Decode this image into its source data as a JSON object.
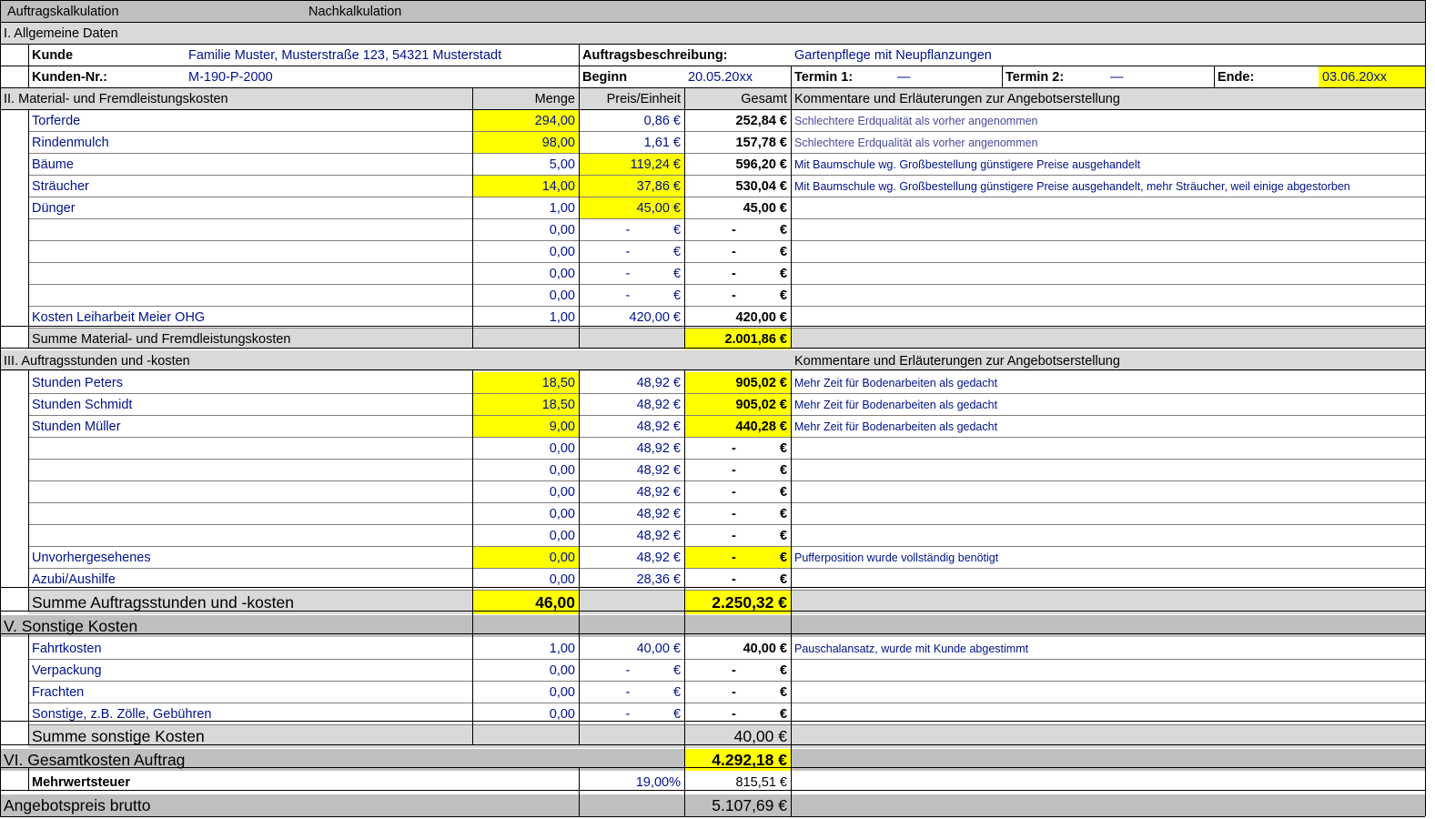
{
  "title_bar": {
    "left": "Auftragskalkulation",
    "right": "Nachkalkulation"
  },
  "section1": {
    "title": "I. Allgemeine Daten",
    "kunde_label": "Kunde",
    "kunde_value": "Familie Muster, Musterstraße 123, 54321 Musterstadt",
    "auftrag_label": "Auftragsbeschreibung:",
    "auftrag_value": "Gartenpflege mit Neupflanzungen",
    "kundennr_label": "Kunden-Nr.:",
    "kundennr_value": "M-190-P-2000",
    "beginn_label": "Beginn",
    "beginn_value": "20.05.20xx",
    "termin1_label": "Termin 1:",
    "termin1_value": "—",
    "termin2_label": "Termin 2:",
    "termin2_value": "—",
    "ende_label": "Ende:",
    "ende_value": "03.06.20xx"
  },
  "section2": {
    "title": "II. Material- und Fremdleistungskosten",
    "col_menge": "Menge",
    "col_preis": "Preis/Einheit",
    "col_gesamt": "Gesamt",
    "col_kommentar": "Kommentare und Erläuterungen zur Angebotserstellung",
    "rows": [
      {
        "name": "Torferde",
        "menge": "294,00",
        "preis": "0,86 €",
        "gesamt": "252,84 €",
        "comment": "Schlechtere Erdqualität als vorher angenommen"
      },
      {
        "name": "Rindenmulch",
        "menge": "98,00",
        "preis": "1,61 €",
        "gesamt": "157,78 €",
        "comment": "Schlechtere Erdqualität als vorher angenommen"
      },
      {
        "name": "Bäume",
        "menge": "5,00",
        "preis": "119,24 €",
        "gesamt": "596,20 €",
        "comment": "Mit Baumschule wg. Großbestellung günstigere Preise ausgehandelt"
      },
      {
        "name": "Sträucher",
        "menge": "14,00",
        "preis": "37,86 €",
        "gesamt": "530,04 €",
        "comment": "Mit Baumschule wg. Großbestellung günstigere Preise ausgehandelt, mehr Sträucher, weil einige abgestorben"
      },
      {
        "name": "Dünger",
        "menge": "1,00",
        "preis": "45,00 €",
        "gesamt": "45,00 €",
        "comment": ""
      },
      {
        "name": "",
        "menge": "0,00",
        "preis": "-",
        "gesamt": "-",
        "comment": ""
      },
      {
        "name": "",
        "menge": "0,00",
        "preis": "-",
        "gesamt": "-",
        "comment": ""
      },
      {
        "name": "",
        "menge": "0,00",
        "preis": "-",
        "gesamt": "-",
        "comment": ""
      },
      {
        "name": "",
        "menge": "0,00",
        "preis": "-",
        "gesamt": "-",
        "comment": ""
      },
      {
        "name": "Kosten Leiharbeit Meier OHG",
        "menge": "1,00",
        "preis": "420,00 €",
        "gesamt": "420,00 €",
        "comment": ""
      }
    ],
    "sum_label": "Summe Material- und Fremdleistungskosten",
    "sum_value": "2.001,86 €"
  },
  "section3": {
    "title": "III. Auftragsstunden und -kosten",
    "col_kommentar": "Kommentare und Erläuterungen zur Angebotserstellung",
    "rows": [
      {
        "name": "Stunden Peters",
        "menge": "18,50",
        "preis": "48,92 €",
        "gesamt": "905,02 €",
        "comment": "Mehr Zeit für Bodenarbeiten als gedacht"
      },
      {
        "name": "Stunden Schmidt",
        "menge": "18,50",
        "preis": "48,92 €",
        "gesamt": "905,02 €",
        "comment": "Mehr Zeit für Bodenarbeiten als gedacht"
      },
      {
        "name": "Stunden Müller",
        "menge": "9,00",
        "preis": "48,92 €",
        "gesamt": "440,28 €",
        "comment": "Mehr Zeit für Bodenarbeiten als gedacht"
      },
      {
        "name": "",
        "menge": "0,00",
        "preis": "48,92 €",
        "gesamt": "-",
        "comment": ""
      },
      {
        "name": "",
        "menge": "0,00",
        "preis": "48,92 €",
        "gesamt": "-",
        "comment": ""
      },
      {
        "name": "",
        "menge": "0,00",
        "preis": "48,92 €",
        "gesamt": "-",
        "comment": ""
      },
      {
        "name": "",
        "menge": "0,00",
        "preis": "48,92 €",
        "gesamt": "-",
        "comment": ""
      },
      {
        "name": "",
        "menge": "0,00",
        "preis": "48,92 €",
        "gesamt": "-",
        "comment": ""
      },
      {
        "name": "Unvorhergesehenes",
        "menge": "0,00",
        "preis": "48,92 €",
        "gesamt": "-",
        "comment": "Pufferposition wurde vollständig benötigt"
      },
      {
        "name": "Azubi/Aushilfe",
        "menge": "0,00",
        "preis": "28,36 €",
        "gesamt": "-",
        "comment": ""
      }
    ],
    "sum_label": "Summe Auftragsstunden und -kosten",
    "sum_menge": "46,00",
    "sum_value": "2.250,32 €"
  },
  "section5": {
    "title": "V. Sonstige Kosten",
    "rows": [
      {
        "name": "Fahrtkosten",
        "menge": "1,00",
        "preis": "40,00 €",
        "gesamt": "40,00 €",
        "comment": "Pauschalansatz, wurde mit Kunde abgestimmt"
      },
      {
        "name": "Verpackung",
        "menge": "0,00",
        "preis": "-",
        "gesamt": "-",
        "comment": ""
      },
      {
        "name": "Frachten",
        "menge": "0,00",
        "preis": "-",
        "gesamt": "-",
        "comment": ""
      },
      {
        "name": "Sonstige, z.B. Zölle, Gebühren",
        "menge": "0,00",
        "preis": "-",
        "gesamt": "-",
        "comment": ""
      }
    ],
    "sum_label": "Summe sonstige Kosten",
    "sum_value": "40,00 €"
  },
  "total": {
    "label": "VI. Gesamtkosten Auftrag",
    "value": "4.292,18 €",
    "mwst_label": "Mehrwertsteuer",
    "mwst_rate": "19,00%",
    "mwst_value": "815,51 €",
    "brutto_label": "Angebotspreis brutto",
    "brutto_value": "5.107,69 €"
  },
  "colors": {
    "highlight": "#ffff00",
    "header_gray": "#bfbfbf",
    "sum_gray": "#d9d9d9",
    "text_blue": "#00138a"
  }
}
